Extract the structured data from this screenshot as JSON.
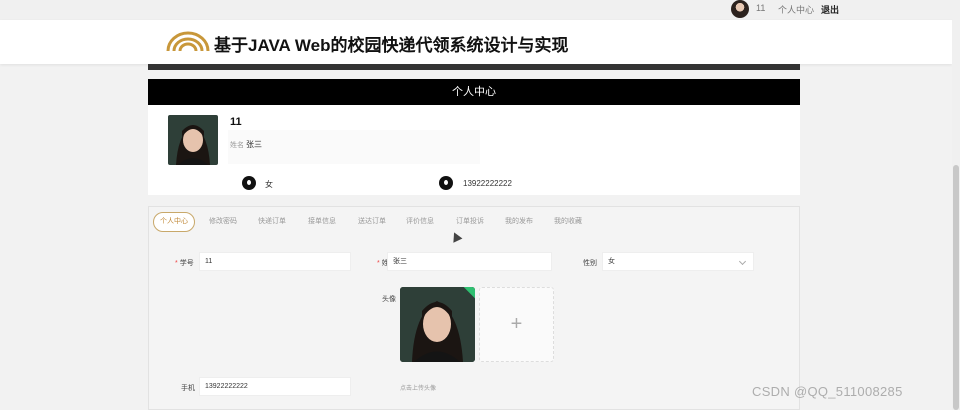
{
  "topbar": {
    "username": "11",
    "center_link": "个人中心",
    "logout": "退出"
  },
  "header": {
    "title": "基于JAVA Web的校园快递代领系统设计与实现",
    "logo_icon": "arc-logo-icon",
    "logo_color": "#c8973a"
  },
  "banner": {
    "title": "个人中心"
  },
  "profile": {
    "username": "11",
    "name_label": "姓名",
    "name_value": "张三",
    "gender": "女",
    "phone": "13922222222"
  },
  "tabs": [
    {
      "label": "个人中心",
      "active": true
    },
    {
      "label": "修改密码"
    },
    {
      "label": "快递订单"
    },
    {
      "label": "接单信息"
    },
    {
      "label": "送达订单"
    },
    {
      "label": "评价信息"
    },
    {
      "label": "订单投诉"
    },
    {
      "label": "我的发布"
    },
    {
      "label": "我的收藏"
    }
  ],
  "form": {
    "student_id_label": "学号",
    "student_id_value": "11",
    "name_label": "姓名",
    "name_value": "张三",
    "gender_label": "性别",
    "gender_value": "女",
    "avatar_label": "头像",
    "upload_hint": "点击上传头像",
    "phone_label": "手机",
    "phone_value": "13922222222"
  },
  "watermark": "CSDN @QQ_511008285",
  "colors": {
    "accent": "#c8a86a",
    "banner_bg": "#000000",
    "badge": "#2fbf71"
  }
}
